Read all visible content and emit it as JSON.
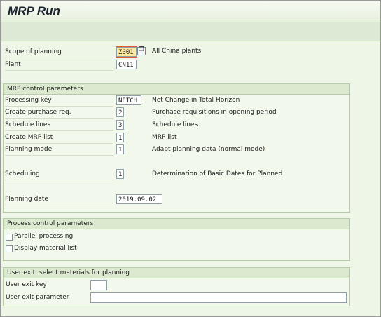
{
  "title": "MRP Run",
  "header": {
    "scope_label": "Scope of planning",
    "scope_value": "Z001",
    "scope_desc": "All China plants",
    "plant_label": "Plant",
    "plant_value": "CN11"
  },
  "mrp_control": {
    "heading": "MRP control parameters",
    "rows": [
      {
        "label": "Processing key",
        "value": "NETCH",
        "desc": "Net Change in Total Horizon"
      },
      {
        "label": "Create purchase req.",
        "value": "2",
        "desc": "Purchase requisitions in opening period"
      },
      {
        "label": "Schedule lines",
        "value": "3",
        "desc": "Schedule lines"
      },
      {
        "label": "Create MRP list",
        "value": "1",
        "desc": "MRP list"
      },
      {
        "label": "Planning mode",
        "value": "1",
        "desc": "Adapt planning data (normal mode)"
      },
      {
        "label": "Scheduling",
        "value": "1",
        "desc": "Determination of Basic Dates for Planned"
      }
    ],
    "planning_date_label": "Planning date",
    "planning_date_value": "2019.09.02"
  },
  "process_control": {
    "heading": "Process control parameters",
    "parallel_label": "Parallel processing",
    "parallel_checked": false,
    "display_label": "Display material list",
    "display_checked": false
  },
  "user_exit": {
    "heading": "User exit: select materials for planning",
    "key_label": "User exit key",
    "key_value": "",
    "param_label": "User exit parameter",
    "param_value": ""
  }
}
